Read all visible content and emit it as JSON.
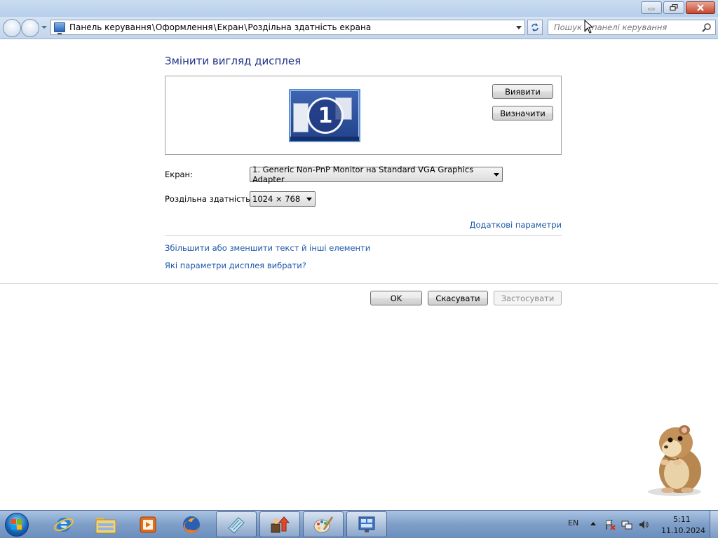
{
  "window": {
    "breadcrumbs": [
      "Панель керування",
      "Оформлення",
      "Екран",
      "Роздільна здатність екрана"
    ],
    "search_placeholder": "Пошук у панелі керування"
  },
  "content": {
    "heading": "Змінити вигляд дисплея",
    "monitor_number": "1",
    "detect_label": "Виявити",
    "identify_label": "Визначити",
    "screen_label": "Екран:",
    "screen_value": "1. Generic Non-PnP Monitor на Standard VGA Graphics Adapter",
    "resolution_label": "Роздільна здатність:",
    "resolution_value": "1024 × 768",
    "advanced_link": "Додаткові параметри",
    "text_size_link": "Збільшити або зменшити текст й інші елементи",
    "which_settings_link": "Які параметри дисплея вибрати?",
    "ok_label": "OK",
    "cancel_label": "Скасувати",
    "apply_label": "Застосувати"
  },
  "taskbar": {
    "apps": [
      "internet-explorer",
      "windows-explorer",
      "media-player",
      "firefox",
      "notepad",
      "app-uploader",
      "paint",
      "control-panel"
    ],
    "language": "EN",
    "time": "5:11",
    "date": "11.10.2024"
  },
  "colors": {
    "heading": "#1e3287",
    "link": "#1a55a8",
    "taskbar": "#7f9fc8"
  }
}
